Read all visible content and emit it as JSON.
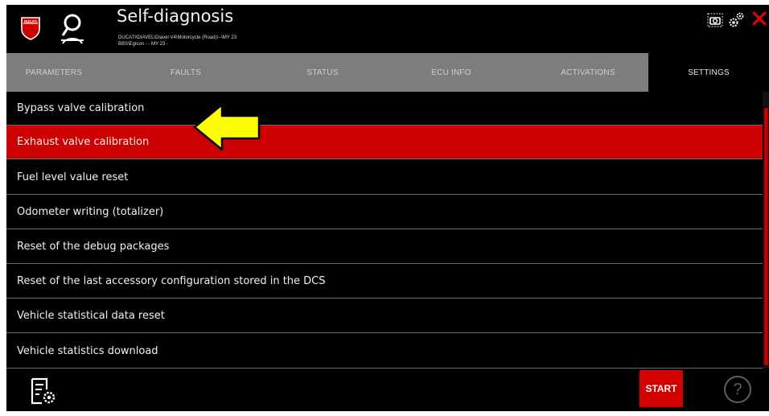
{
  "header": {
    "title": "Self-diagnosis",
    "path_line1": "DUCATI\\DIAVEL\\Diavel V4\\Motorcycle (Road)\\--\\MY 23",
    "path_line2": "BBS\\Egicon - - MY 23 -",
    "logo_text": "DUCATI"
  },
  "tabs": [
    {
      "label": "PARAMETERS"
    },
    {
      "label": "FAULTS"
    },
    {
      "label": "STATUS"
    },
    {
      "label": "ECU INFO"
    },
    {
      "label": "ACTIVATIONS"
    },
    {
      "label": "SETTINGS"
    }
  ],
  "active_tab": "SETTINGS",
  "list": {
    "items": [
      {
        "label": "Bypass valve calibration"
      },
      {
        "label": "Exhaust valve calibration"
      },
      {
        "label": "Fuel level value reset"
      },
      {
        "label": "Odometer writing (totalizer)"
      },
      {
        "label": "Reset of the debug packages"
      },
      {
        "label": "Reset of the last accessory configuration stored in the DCS"
      },
      {
        "label": "Vehicle statistical data reset"
      },
      {
        "label": "Vehicle statistics download"
      }
    ],
    "selected": "Exhaust valve calibration"
  },
  "footer": {
    "start_label": "START",
    "help_label": "?"
  },
  "colors": {
    "accent_red": "#cc0000",
    "tab_gray": "#7d7d7d",
    "arrow_yellow": "#ffff00"
  },
  "icons": [
    "ducati-logo-icon",
    "search-icon",
    "camera-icon",
    "gears-icon",
    "close-icon",
    "arrow-pointer-icon",
    "document-settings-icon",
    "help-icon"
  ]
}
